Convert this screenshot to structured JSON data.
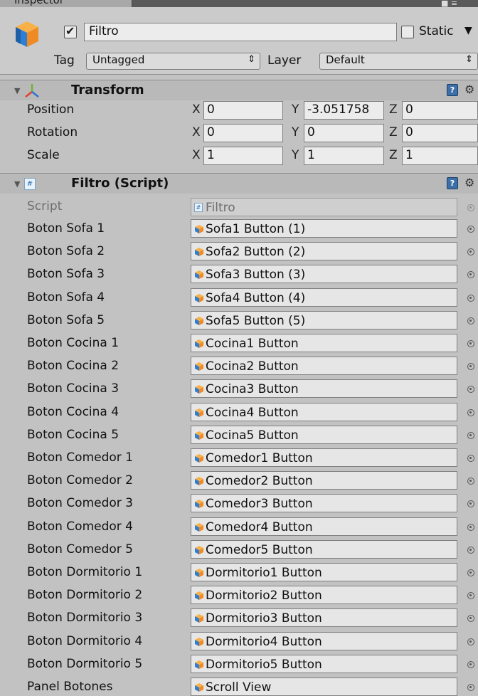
{
  "window": {
    "tab_title": "Inspector"
  },
  "header": {
    "active": true,
    "object_name": "Filtro",
    "static_label": "Static",
    "static_checked": false,
    "tag_label": "Tag",
    "tag_value": "Untagged",
    "layer_label": "Layer",
    "layer_value": "Default"
  },
  "transform": {
    "title": "Transform",
    "rows": [
      {
        "label": "Position",
        "x": "0",
        "y": "-3.051758",
        "z": "0"
      },
      {
        "label": "Rotation",
        "x": "0",
        "y": "0",
        "z": "0"
      },
      {
        "label": "Scale",
        "x": "1",
        "y": "1",
        "z": "1"
      }
    ],
    "axis_labels": [
      "X",
      "Y",
      "Z"
    ]
  },
  "script_component": {
    "title": "Filtro (Script)",
    "script_label": "Script",
    "script_value": "Filtro",
    "fields": [
      {
        "label": "Boton Sofa 1",
        "value": "Sofa1 Button (1)"
      },
      {
        "label": "Boton Sofa 2",
        "value": "Sofa2 Button (2)"
      },
      {
        "label": "Boton Sofa 3",
        "value": "Sofa3 Button (3)"
      },
      {
        "label": "Boton Sofa 4",
        "value": "Sofa4 Button (4)"
      },
      {
        "label": "Boton Sofa 5",
        "value": "Sofa5 Button (5)"
      },
      {
        "label": "Boton Cocina 1",
        "value": "Cocina1 Button"
      },
      {
        "label": "Boton Cocina 2",
        "value": "Cocina2 Button"
      },
      {
        "label": "Boton Cocina 3",
        "value": "Cocina3 Button"
      },
      {
        "label": "Boton Cocina 4",
        "value": "Cocina4 Button"
      },
      {
        "label": "Boton Cocina 5",
        "value": "Cocina5 Button"
      },
      {
        "label": "Boton Comedor 1",
        "value": "Comedor1 Button"
      },
      {
        "label": "Boton Comedor 2",
        "value": "Comedor2 Button"
      },
      {
        "label": "Boton Comedor 3",
        "value": "Comedor3 Button"
      },
      {
        "label": "Boton Comedor 4",
        "value": "Comedor4 Button"
      },
      {
        "label": "Boton Comedor 5",
        "value": "Comedor5 Button"
      },
      {
        "label": "Boton Dormitorio 1",
        "value": "Dormitorio1 Button"
      },
      {
        "label": "Boton Dormitorio 2",
        "value": "Dormitorio2 Button"
      },
      {
        "label": "Boton Dormitorio 3",
        "value": "Dormitorio3 Button"
      },
      {
        "label": "Boton Dormitorio 4",
        "value": "Dormitorio4 Button"
      },
      {
        "label": "Boton Dormitorio 5",
        "value": "Dormitorio5 Button"
      },
      {
        "label": "Panel Botones",
        "value": "Scroll View"
      }
    ]
  },
  "icons": {
    "gameobject": "cube-icon",
    "transform": "transform-axes-icon",
    "script": "csharp-script-icon",
    "help": "help-book-icon",
    "settings": "gear-icon",
    "object_picker": "object-picker-icon"
  },
  "colors": {
    "panel_bg": "#c2c2c2",
    "section_header_bg": "#b9b9b9",
    "field_bg": "#ececec",
    "cube_orange": "#f08a24",
    "cube_blue": "#2d7fd6"
  }
}
